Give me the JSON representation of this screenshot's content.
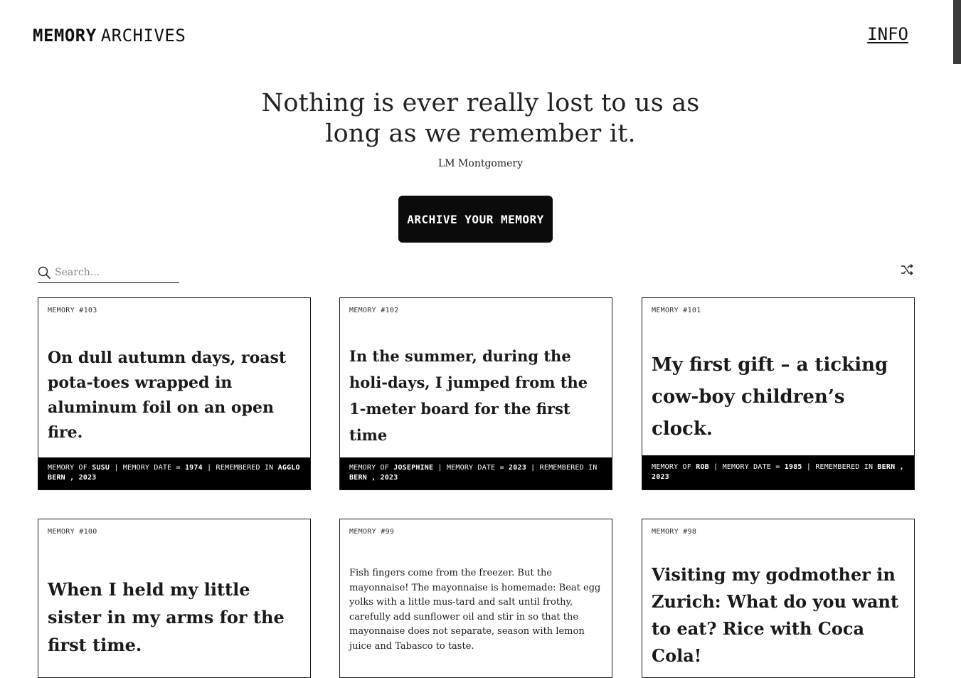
{
  "header": {
    "logo_word1": "MEMORY",
    "logo_word2": "ARCHIVES",
    "info_label": "INFO"
  },
  "hero": {
    "quote_line1": "Nothing is ever really lost to us as",
    "quote_line2": "long as we remember it.",
    "author": "LM Montgomery",
    "cta_label": "ARCHIVE YOUR MEMORY"
  },
  "search": {
    "placeholder": "Search...",
    "icon": "search-icon"
  },
  "shuffle_icon": "shuffle-icon",
  "meta_labels": {
    "memory_of": "MEMORY OF",
    "memory_date": "MEMORY DATE =",
    "remembered_in": "REMEMBERED IN",
    "separator": "|"
  },
  "cards": [
    {
      "number": "MEMORY #103",
      "text": "On dull autumn days, roast pota-toes wrapped in aluminum foil on an open fire.",
      "name": "SUSU",
      "date": "1974",
      "place": "AGGLO BERN",
      "year": ", 2023"
    },
    {
      "number": "MEMORY #102",
      "text": "In the summer, during the holi-days, I jumped from the 1-meter board for the first time",
      "name": "JOSEPHINE",
      "date": "2023",
      "place": "BERN",
      "year": ", 2023"
    },
    {
      "number": "MEMORY #101",
      "text": "My first gift – a ticking cow-boy children’s clock.",
      "name": "ROB",
      "date": "1985",
      "place": "BERN",
      "year": ", 2023"
    },
    {
      "number": "MEMORY #100",
      "text": "When I held my little sister in my arms for the first time."
    },
    {
      "number": "MEMORY #99",
      "text": "Fish fingers come from the freezer. But the mayonnaise! The mayonnaise is homemade: Beat egg yolks with a little mus-tard and salt until frothy, carefully add sunflower oil and stir in so that the mayonnaise does not separate, season with lemon juice and Tabasco to taste."
    },
    {
      "number": "MEMORY #98",
      "text": "Visiting my godmother in Zurich: What do you want to eat? Rice with Coca Cola!"
    }
  ]
}
